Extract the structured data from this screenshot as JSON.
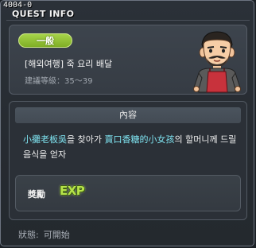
{
  "window": {
    "id": "4004-0",
    "title": "QUEST INFO"
  },
  "quest": {
    "category": "一般",
    "name": "[해외여행] 죽 요리 배달",
    "level_requirement": "建議等級：35～39",
    "npc_icon": "npc-portrait-mustached-man"
  },
  "details": {
    "section_title": "內容",
    "description": {
      "part1": "小攤老板吳",
      "part2": "을 찾아가 ",
      "part3": "賣口香糖的小女孩",
      "part4": "의 할머니께 드릴 음식을 얻자"
    }
  },
  "reward": {
    "label": "獎勵",
    "type": "EXP",
    "icon": "exp-icon"
  },
  "status": {
    "label": "狀態:",
    "value": "可開始"
  },
  "colors": {
    "badge": "#8dbd2e",
    "highlight": "#7fe3f0",
    "exp": "#b6e34a"
  }
}
